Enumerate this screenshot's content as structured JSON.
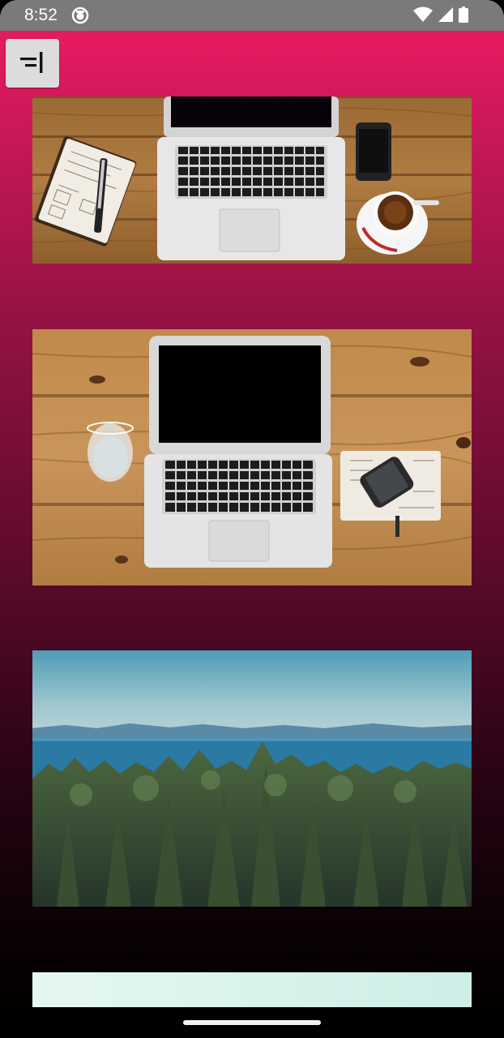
{
  "status_bar": {
    "time": "8:52",
    "icons": [
      "app-notification-icon",
      "wifi-icon",
      "cellular-signal-icon",
      "battery-icon"
    ]
  },
  "toolbar": {
    "menu_icon": "menu-align-right-icon"
  },
  "gallery": {
    "images": [
      {
        "subject": "laptop-notebook-coffee-on-wood-desk"
      },
      {
        "subject": "laptop-glass-phone-on-wood-desk"
      },
      {
        "subject": "forest-and-lake-landscape"
      },
      {
        "subject": "light-sky-partial"
      }
    ]
  },
  "colors": {
    "gradient_top": "#e81c62",
    "gradient_bottom": "#000000",
    "status_bar": "#7a7a7a",
    "menu_button": "#dcdcdc"
  }
}
